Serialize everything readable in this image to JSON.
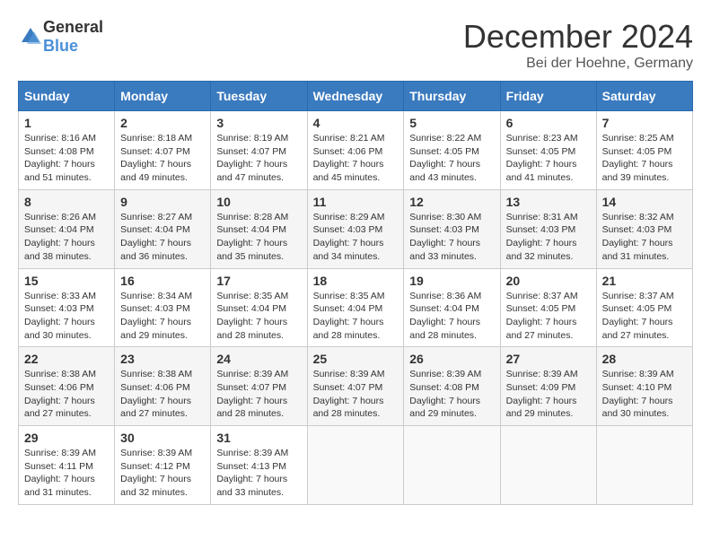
{
  "header": {
    "logo_general": "General",
    "logo_blue": "Blue",
    "month_title": "December 2024",
    "subtitle": "Bei der Hoehne, Germany"
  },
  "days_of_week": [
    "Sunday",
    "Monday",
    "Tuesday",
    "Wednesday",
    "Thursday",
    "Friday",
    "Saturday"
  ],
  "weeks": [
    [
      {
        "day": "1",
        "sunrise": "8:16 AM",
        "sunset": "4:08 PM",
        "daylight": "7 hours and 51 minutes."
      },
      {
        "day": "2",
        "sunrise": "8:18 AM",
        "sunset": "4:07 PM",
        "daylight": "7 hours and 49 minutes."
      },
      {
        "day": "3",
        "sunrise": "8:19 AM",
        "sunset": "4:07 PM",
        "daylight": "7 hours and 47 minutes."
      },
      {
        "day": "4",
        "sunrise": "8:21 AM",
        "sunset": "4:06 PM",
        "daylight": "7 hours and 45 minutes."
      },
      {
        "day": "5",
        "sunrise": "8:22 AM",
        "sunset": "4:05 PM",
        "daylight": "7 hours and 43 minutes."
      },
      {
        "day": "6",
        "sunrise": "8:23 AM",
        "sunset": "4:05 PM",
        "daylight": "7 hours and 41 minutes."
      },
      {
        "day": "7",
        "sunrise": "8:25 AM",
        "sunset": "4:05 PM",
        "daylight": "7 hours and 39 minutes."
      }
    ],
    [
      {
        "day": "8",
        "sunrise": "8:26 AM",
        "sunset": "4:04 PM",
        "daylight": "7 hours and 38 minutes."
      },
      {
        "day": "9",
        "sunrise": "8:27 AM",
        "sunset": "4:04 PM",
        "daylight": "7 hours and 36 minutes."
      },
      {
        "day": "10",
        "sunrise": "8:28 AM",
        "sunset": "4:04 PM",
        "daylight": "7 hours and 35 minutes."
      },
      {
        "day": "11",
        "sunrise": "8:29 AM",
        "sunset": "4:03 PM",
        "daylight": "7 hours and 34 minutes."
      },
      {
        "day": "12",
        "sunrise": "8:30 AM",
        "sunset": "4:03 PM",
        "daylight": "7 hours and 33 minutes."
      },
      {
        "day": "13",
        "sunrise": "8:31 AM",
        "sunset": "4:03 PM",
        "daylight": "7 hours and 32 minutes."
      },
      {
        "day": "14",
        "sunrise": "8:32 AM",
        "sunset": "4:03 PM",
        "daylight": "7 hours and 31 minutes."
      }
    ],
    [
      {
        "day": "15",
        "sunrise": "8:33 AM",
        "sunset": "4:03 PM",
        "daylight": "7 hours and 30 minutes."
      },
      {
        "day": "16",
        "sunrise": "8:34 AM",
        "sunset": "4:03 PM",
        "daylight": "7 hours and 29 minutes."
      },
      {
        "day": "17",
        "sunrise": "8:35 AM",
        "sunset": "4:04 PM",
        "daylight": "7 hours and 28 minutes."
      },
      {
        "day": "18",
        "sunrise": "8:35 AM",
        "sunset": "4:04 PM",
        "daylight": "7 hours and 28 minutes."
      },
      {
        "day": "19",
        "sunrise": "8:36 AM",
        "sunset": "4:04 PM",
        "daylight": "7 hours and 28 minutes."
      },
      {
        "day": "20",
        "sunrise": "8:37 AM",
        "sunset": "4:05 PM",
        "daylight": "7 hours and 27 minutes."
      },
      {
        "day": "21",
        "sunrise": "8:37 AM",
        "sunset": "4:05 PM",
        "daylight": "7 hours and 27 minutes."
      }
    ],
    [
      {
        "day": "22",
        "sunrise": "8:38 AM",
        "sunset": "4:06 PM",
        "daylight": "7 hours and 27 minutes."
      },
      {
        "day": "23",
        "sunrise": "8:38 AM",
        "sunset": "4:06 PM",
        "daylight": "7 hours and 27 minutes."
      },
      {
        "day": "24",
        "sunrise": "8:39 AM",
        "sunset": "4:07 PM",
        "daylight": "7 hours and 28 minutes."
      },
      {
        "day": "25",
        "sunrise": "8:39 AM",
        "sunset": "4:07 PM",
        "daylight": "7 hours and 28 minutes."
      },
      {
        "day": "26",
        "sunrise": "8:39 AM",
        "sunset": "4:08 PM",
        "daylight": "7 hours and 29 minutes."
      },
      {
        "day": "27",
        "sunrise": "8:39 AM",
        "sunset": "4:09 PM",
        "daylight": "7 hours and 29 minutes."
      },
      {
        "day": "28",
        "sunrise": "8:39 AM",
        "sunset": "4:10 PM",
        "daylight": "7 hours and 30 minutes."
      }
    ],
    [
      {
        "day": "29",
        "sunrise": "8:39 AM",
        "sunset": "4:11 PM",
        "daylight": "7 hours and 31 minutes."
      },
      {
        "day": "30",
        "sunrise": "8:39 AM",
        "sunset": "4:12 PM",
        "daylight": "7 hours and 32 minutes."
      },
      {
        "day": "31",
        "sunrise": "8:39 AM",
        "sunset": "4:13 PM",
        "daylight": "7 hours and 33 minutes."
      },
      null,
      null,
      null,
      null
    ]
  ]
}
